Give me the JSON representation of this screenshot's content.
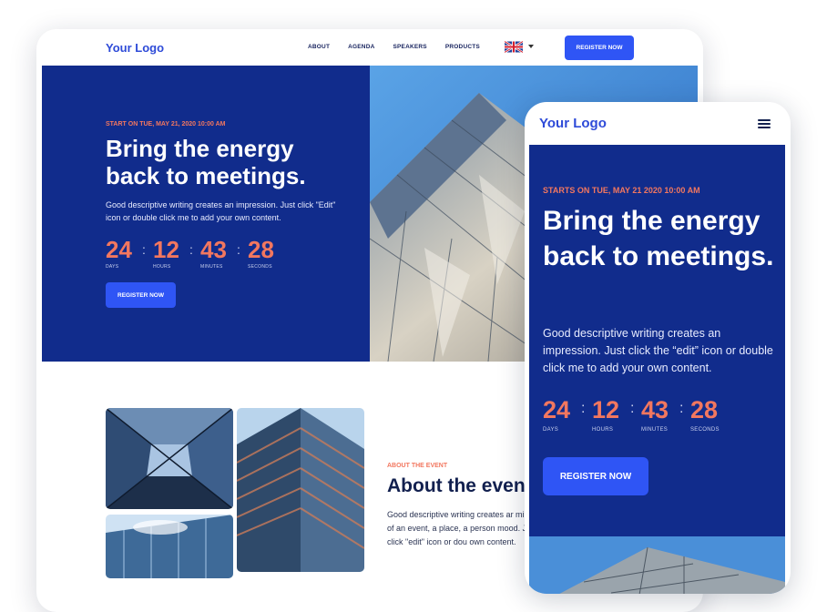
{
  "colors": {
    "navy": "#112c8c",
    "accent": "#f2775f",
    "button": "#2f55f5",
    "logo": "#2e4bd8"
  },
  "desktop": {
    "nav": {
      "logo": "Your Logo",
      "menu": [
        "ABOUT",
        "AGENDA",
        "SPEAKERS",
        "PRODUCTS"
      ],
      "language_icon": "uk-flag-icon",
      "register": "REGISTER NOW"
    },
    "hero": {
      "eyebrow": "START ON TUE, MAY 21, 2020 10:00 AM",
      "title": "Bring the energy back to meetings.",
      "description": "Good descriptive writing creates an impression. Just click \"Edit\" icon or double click me to add your own content.",
      "countdown": [
        {
          "value": "24",
          "label": "DAYS"
        },
        {
          "value": "12",
          "label": "HOURS"
        },
        {
          "value": "43",
          "label": "MINUTES"
        },
        {
          "value": "28",
          "label": "SECONDS"
        }
      ],
      "button": "REGISTER NOW"
    },
    "about": {
      "eyebrow": "ABOUT THE EVENT",
      "title": "About the even",
      "description": "Good descriptive writing creates ar mind of an event, a place, a person mood. Just click \"edit\" icon or dou own content."
    }
  },
  "mobile": {
    "logo": "Your Logo",
    "menu_icon": "hamburger-menu-icon",
    "hero": {
      "eyebrow": "STARTS ON TUE, MAY 21 2020 10:00 AM",
      "title": "Bring the energy back to meetings.",
      "description": "Good descriptive writing creates an impression. Just click the “edit” icon or double click me to add your own content.",
      "countdown": [
        {
          "value": "24",
          "label": "DAYS"
        },
        {
          "value": "12",
          "label": "HOURS"
        },
        {
          "value": "43",
          "label": "MINUTES"
        },
        {
          "value": "28",
          "label": "SECONDS"
        }
      ],
      "button": "REGISTER NOW"
    }
  }
}
